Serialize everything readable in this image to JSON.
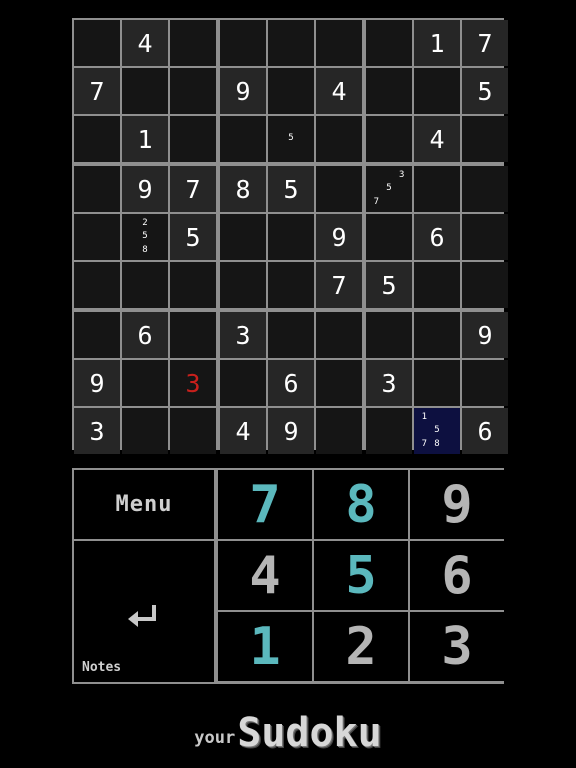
{
  "board": {
    "cells": [
      [
        "",
        "4",
        "",
        "",
        "",
        "",
        "",
        "1",
        "7"
      ],
      [
        "7",
        "",
        "",
        "9",
        "",
        "4",
        "",
        "",
        "5"
      ],
      [
        "",
        "1",
        "",
        "",
        "",
        "",
        "",
        "4",
        ""
      ],
      [
        "",
        "9",
        "7",
        "8",
        "5",
        "",
        "",
        "",
        ""
      ],
      [
        "",
        "",
        "5",
        "",
        "",
        "9",
        "",
        "6",
        ""
      ],
      [
        "",
        "",
        "",
        "",
        "",
        "7",
        "5",
        "",
        ""
      ],
      [
        "",
        "6",
        "",
        "3",
        "",
        "",
        "",
        "",
        "9"
      ],
      [
        "9",
        "",
        "3",
        "",
        "6",
        "",
        "3",
        "",
        ""
      ],
      [
        "3",
        "",
        "",
        "4",
        "9",
        "",
        "",
        "",
        "6"
      ]
    ],
    "notes": [
      {
        "row": 2,
        "col": 4,
        "digits": [
          "5"
        ]
      },
      {
        "row": 3,
        "col": 6,
        "digits": [
          "7",
          "5",
          "3"
        ]
      },
      {
        "row": 4,
        "col": 1,
        "digits": [
          "8",
          "5",
          "2"
        ]
      },
      {
        "row": 8,
        "col": 7,
        "digits": [
          "7",
          "8",
          "5",
          "1"
        ]
      }
    ],
    "conflict_cell": {
      "row": 7,
      "col": 2
    },
    "selected_cell": {
      "row": 8,
      "col": 7
    }
  },
  "keypad": {
    "menu_label": "Menu",
    "notes_label": "Notes",
    "enter_icon": "return-arrow-icon",
    "digits": [
      "7",
      "8",
      "9",
      "4",
      "5",
      "6",
      "1",
      "2",
      "3"
    ],
    "highlighted_digits": [
      "7",
      "8",
      "5",
      "1"
    ]
  },
  "brand": {
    "small": "your",
    "large": "Sudoku"
  },
  "colors": {
    "background": "#000000",
    "grid_line": "#8f8f8f",
    "cell_dark": "#151515",
    "cell_shade": "#262626",
    "selected_cell": "#0d1040",
    "conflict": "#c8201c",
    "highlight_digit": "#5bb8bd",
    "normal_digit": "#b5b5b5"
  }
}
